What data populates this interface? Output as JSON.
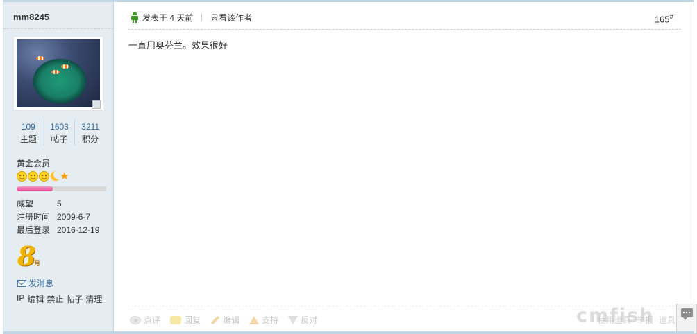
{
  "user": {
    "name": "mm8245",
    "stats": [
      {
        "value": "109",
        "label": "主题"
      },
      {
        "value": "1603",
        "label": "帖子"
      },
      {
        "value": "3211",
        "label": "积分"
      }
    ],
    "group": "黄金会员",
    "exp_progress": 0.4,
    "info": [
      {
        "key": "威望",
        "value": "5"
      },
      {
        "key": "注册时间",
        "value": "2009-6-7"
      },
      {
        "key": "最后登录",
        "value": "2016-12-19"
      }
    ],
    "medal_text": "8",
    "medal_sub": "月",
    "pm_label": "发消息",
    "admin_links": [
      "IP",
      "编辑",
      "禁止",
      "帖子",
      "清理"
    ]
  },
  "post": {
    "time": "发表于 4 天前",
    "separator": "|",
    "only_author": "只看该作者",
    "floor": "165",
    "floor_mark": "#",
    "message": "一直用奥芬兰。效果很好"
  },
  "actions": {
    "rate": "点评",
    "reply": "回复",
    "edit": "编辑",
    "support": "支持",
    "oppose": "反对"
  },
  "right_tools": [
    "使用道具",
    "举报",
    "道具"
  ],
  "watermark": "cmfish",
  "colors": {
    "border": "#c2d5e3",
    "sidebar_bg": "#e5edf2",
    "link": "#336699",
    "exp_fill": "#e2468f"
  }
}
